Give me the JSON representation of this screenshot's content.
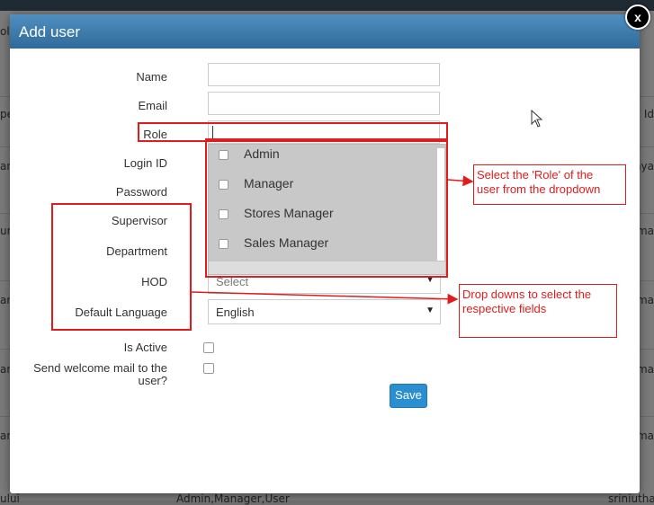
{
  "background": {
    "left_fragments": [
      "ole",
      "pe",
      "an",
      "un",
      "an",
      "an",
      "an"
    ],
    "right_fragments": [
      "Id",
      "hya",
      "ma",
      "ma",
      "ma",
      "ma",
      "ma"
    ],
    "bottom_fragments": [
      "ului",
      "Admin,Manager,User",
      "sriniutha"
    ]
  },
  "modal": {
    "title": "Add user",
    "close_label": "x",
    "form": {
      "name_label": "Name",
      "email_label": "Email",
      "role_label": "Role",
      "login_id_label": "Login ID",
      "password_label": "Password",
      "supervisor_label": "Supervisor",
      "department_label": "Department",
      "hod_label": "HOD",
      "default_language_label": "Default Language",
      "is_active_label": "Is Active",
      "welcome_mail_label_1": "Send welcome mail to the",
      "welcome_mail_label_2": "user?",
      "hod_value": "Select",
      "default_language_value": "English",
      "save_label": "Save"
    },
    "role_dropdown": {
      "options": [
        "Admin",
        "Manager",
        "Stores Manager",
        "Sales Manager"
      ]
    }
  },
  "annotations": {
    "role_callout_1": "Select the  'Role' of the",
    "role_callout_2": "user from the dropdown",
    "dropdowns_callout_1": "Drop downs to select the",
    "dropdowns_callout_2": "respective fields"
  },
  "colors": {
    "header": "#3a78a8",
    "save_button": "#2a8fd0",
    "annotation_red": "#e21c1c",
    "dropdown_bg": "#c8c8c8"
  }
}
